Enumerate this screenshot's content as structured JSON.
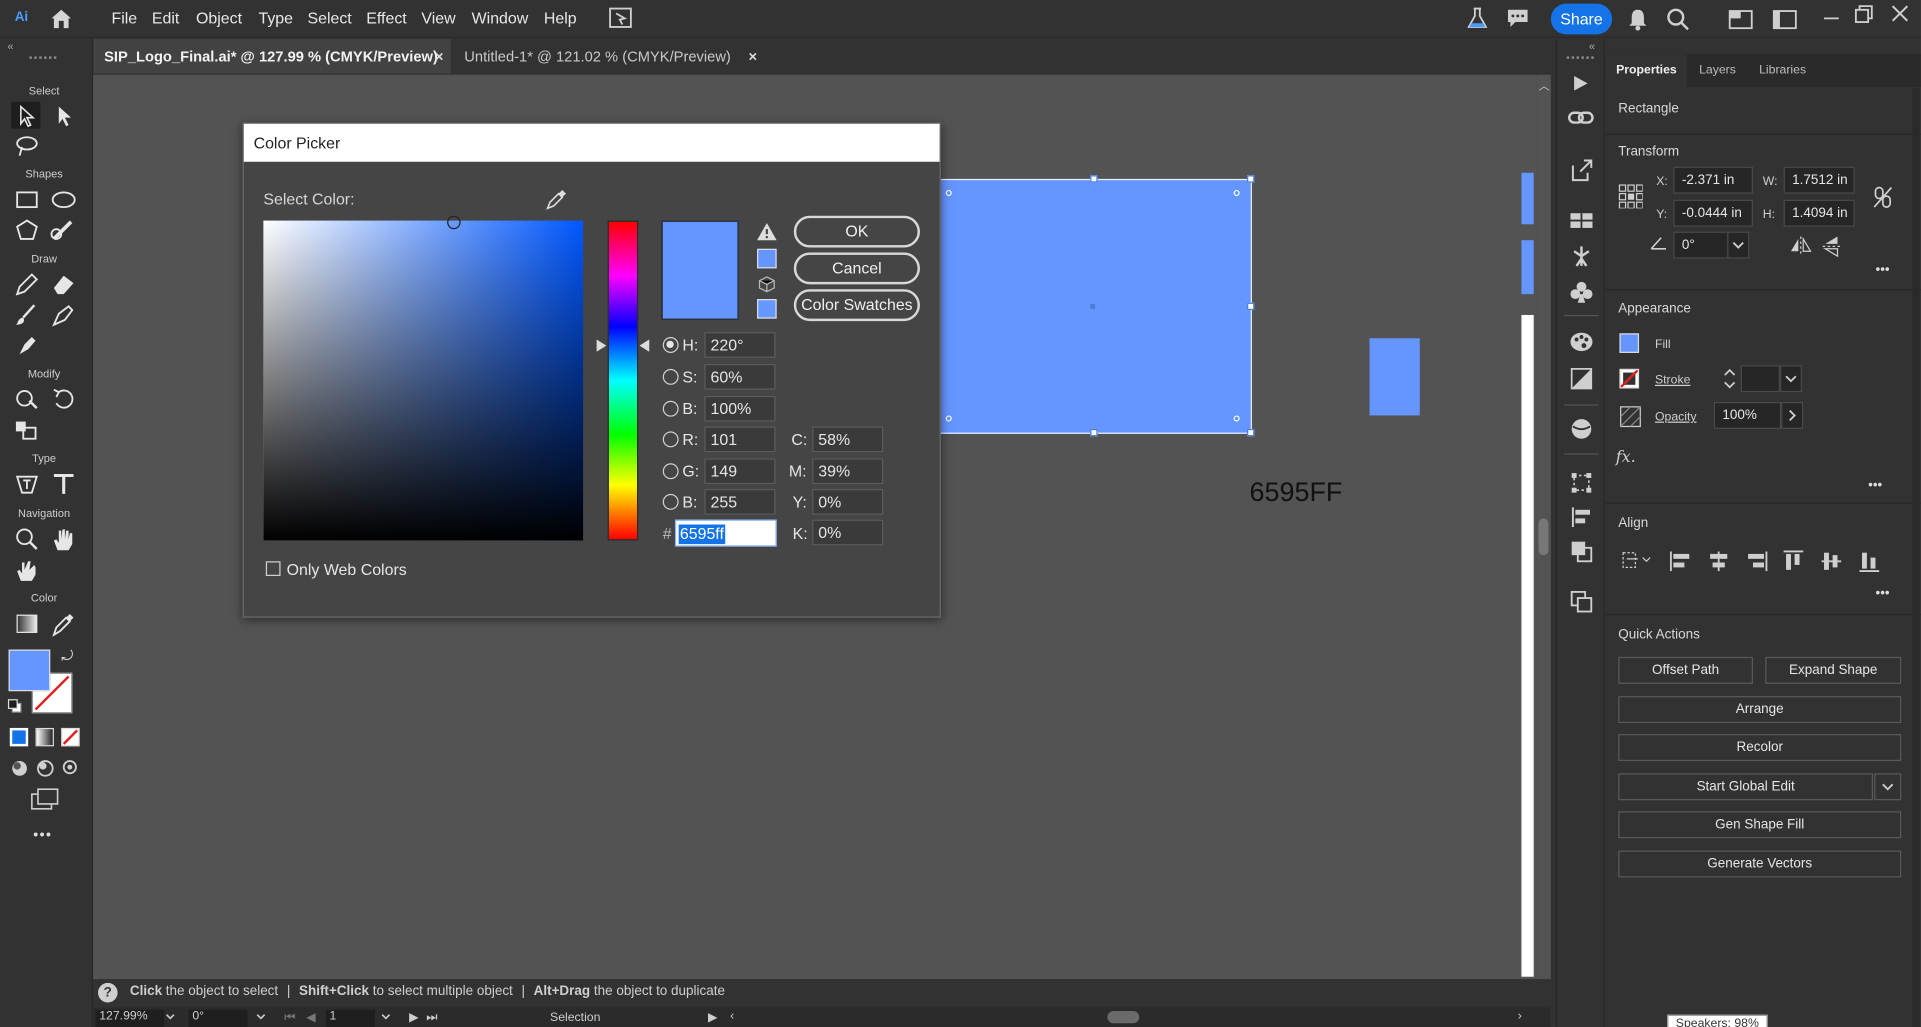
{
  "app": {
    "logo": "Ai"
  },
  "menu": [
    "File",
    "Edit",
    "Object",
    "Type",
    "Select",
    "Effect",
    "View",
    "Window",
    "Help"
  ],
  "share_label": "Share",
  "tabs": [
    {
      "label": "SIP_Logo_Final.ai* @ 127.99 % (CMYK/Preview)",
      "close": "×"
    },
    {
      "label": "Untitled-1* @ 121.02 % (CMYK/Preview)",
      "close": "×"
    }
  ],
  "toolbar": {
    "sections": [
      "Select",
      "Shapes",
      "Draw",
      "Modify",
      "Type",
      "Navigation",
      "Color"
    ],
    "more": "•••"
  },
  "canvas": {
    "hex_text": "6595FF",
    "fill_color": "#6595ff"
  },
  "color_picker": {
    "title": "Color Picker",
    "select_color_label": "Select Color:",
    "buttons": {
      "ok": "OK",
      "cancel": "Cancel",
      "swatches": "Color Swatches"
    },
    "only_web_label": "Only Web Colors",
    "hsb": [
      {
        "label": "H:",
        "value": "220°"
      },
      {
        "label": "S:",
        "value": "60%"
      },
      {
        "label": "B:",
        "value": "100%"
      }
    ],
    "rgb": [
      {
        "label": "R:",
        "value": "101"
      },
      {
        "label": "G:",
        "value": "149"
      },
      {
        "label": "B:",
        "value": "255"
      }
    ],
    "cmyk": [
      {
        "label": "C:",
        "value": "58%"
      },
      {
        "label": "M:",
        "value": "39%"
      },
      {
        "label": "Y:",
        "value": "0%"
      },
      {
        "label": "K:",
        "value": "0%"
      }
    ],
    "hex_label": "#",
    "hex_value": "6595ff",
    "current_color": "#6595ff"
  },
  "properties": {
    "tabs": [
      "Properties",
      "Layers",
      "Libraries"
    ],
    "object_type": "Rectangle",
    "transform": {
      "title": "Transform",
      "x_label": "X:",
      "x": "-2.371 in",
      "y_label": "Y:",
      "y": "-0.0444 in",
      "w_label": "W:",
      "w": "1.7512 in",
      "h_label": "H:",
      "h": "1.4094 in",
      "angle": "0°"
    },
    "appearance": {
      "title": "Appearance",
      "fill": "Fill",
      "stroke": "Stroke",
      "opacity_label": "Opacity",
      "opacity": "100%"
    },
    "fx": "fx.",
    "align": {
      "title": "Align"
    },
    "quick_actions": {
      "title": "Quick Actions",
      "offset_path": "Offset Path",
      "expand_shape": "Expand Shape",
      "arrange": "Arrange",
      "recolor": "Recolor",
      "start_global_edit": "Start Global Edit",
      "gen_shape_fill": "Gen Shape Fill",
      "generate_vectors": "Generate Vectors"
    },
    "more": "•••"
  },
  "status": {
    "hint1_bold": "Click",
    "hint1": " the object to select",
    "hint2_bold": "Shift+Click",
    "hint2": " to select multiple object",
    "hint3_bold": "Alt+Drag",
    "hint3": " the object to duplicate",
    "separator": "|",
    "help": "?"
  },
  "navbar": {
    "zoom": "127.99%",
    "rotate": "0°",
    "artboard": "1",
    "mode": "Selection"
  },
  "tooltip": "Speakers: 98%"
}
